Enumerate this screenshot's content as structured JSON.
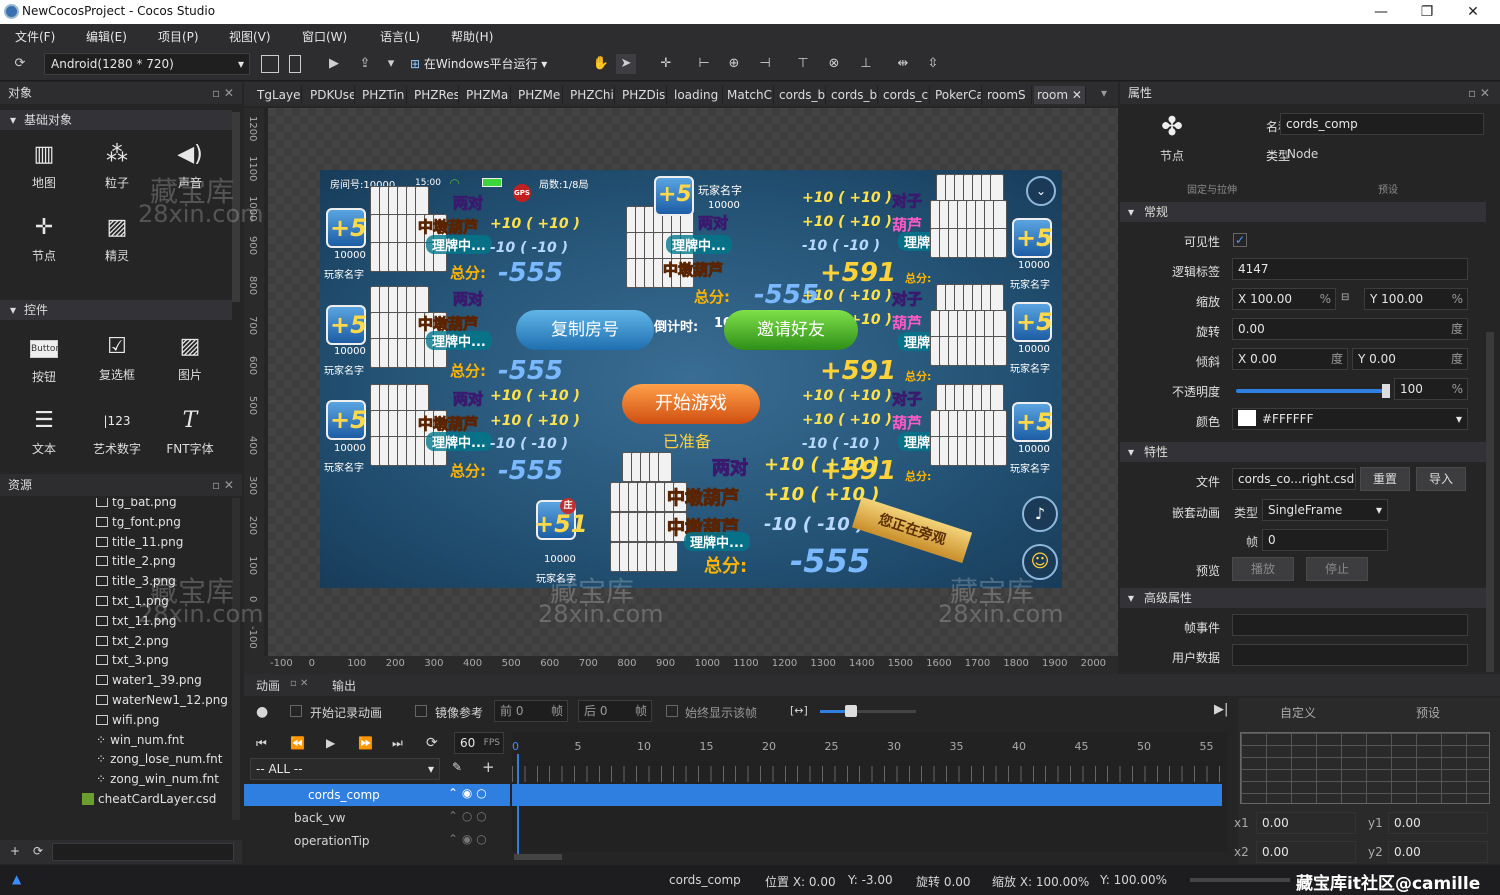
{
  "window": {
    "title": "NewCocosProject - Cocos Studio",
    "minimize": "—",
    "restore": "❐",
    "close": "✕"
  },
  "menu": [
    "文件(F)",
    "编辑(E)",
    "项目(P)",
    "视图(V)",
    "窗口(W)",
    "语言(L)",
    "帮助(H)"
  ],
  "toolbar": {
    "resolution": "Android(1280 * 720)",
    "run_label": "在Windows平台运行"
  },
  "objects_panel": {
    "title": "对象",
    "basic_section": "基础对象",
    "basic_items": [
      "地图",
      "粒子",
      "声音",
      "节点",
      "精灵"
    ],
    "controls_section": "控件",
    "control_items": [
      "按钮",
      "复选框",
      "图片",
      "文本",
      "艺术数字",
      "FNT字体"
    ]
  },
  "resources_panel": {
    "title": "资源",
    "files": [
      "tg_bat.png",
      "tg_font.png",
      "title_11.png",
      "title_2.png",
      "title_3.png",
      "txt_1.png",
      "txt_11.png",
      "txt_2.png",
      "txt_3.png",
      "water1_39.png",
      "waterNew1_12.png",
      "wifi.png",
      "win_num.fnt",
      "zong_lose_num.fnt",
      "zong_win_num.fnt",
      "cheatCardLayer.csd"
    ]
  },
  "tabs": [
    "TgLayer",
    "PDKUse",
    "PHZTin",
    "PHZRes",
    "PHZMa",
    "PHZMe",
    "PHZChi",
    "PHZDis",
    "loading",
    "MatchC",
    "cords_b",
    "cords_b",
    "cords_c",
    "PokerCa",
    "roomS",
    "room"
  ],
  "ruler_x": [
    "-100",
    "0",
    "100",
    "200",
    "300",
    "400",
    "500",
    "600",
    "700",
    "800",
    "900",
    "1000",
    "1100",
    "1200",
    "1300",
    "1400",
    "1500",
    "1600",
    "1700",
    "1800",
    "1900",
    "2000"
  ],
  "ruler_y": [
    "1200",
    "1100",
    "1000",
    "900",
    "800",
    "700",
    "600",
    "500",
    "400",
    "300",
    "200",
    "100",
    "0",
    "-100"
  ],
  "game": {
    "room": "房间号:10000",
    "time": "15:00",
    "rounds": "局数:1/8局",
    "player_name": "玩家名字",
    "score": "10000",
    "pair": "两对",
    "gourd": "中墩葫芦",
    "gourd2": "葫芦",
    "pair2": "对子",
    "plus": "+10 ( +10 )",
    "minus": "-10 ( -10 )",
    "arranging": "理牌中...",
    "total": "总分:",
    "total_neg": "-555",
    "total_pos": "+591",
    "copy_room": "复制房号",
    "countdown": "倒计时:",
    "countdown_val": "10",
    "invite": "邀请好友",
    "start": "开始游戏",
    "ready": "已准备",
    "watching": "您正在旁观",
    "zhuang": "庄",
    "gps": "GPS",
    "plus5": "+5",
    "plus51": "+51"
  },
  "properties": {
    "title": "属性",
    "node_label": "节点",
    "name_label": "名称",
    "name_value": "cords_comp",
    "type_label": "类型",
    "type_value": "Node",
    "fixed_stretch": "固定与拉伸",
    "preset": "预设",
    "general": "常规",
    "visible_label": "可见性",
    "tag_label": "逻辑标签",
    "tag_value": "4147",
    "scale_label": "缩放",
    "scale_x": "100.00",
    "scale_y": "100.00",
    "rotation_label": "旋转",
    "rotation_value": "0.00",
    "skew_label": "倾斜",
    "skew_x": "0.00",
    "skew_y": "0.00",
    "opacity_label": "不透明度",
    "opacity_value": "100",
    "color_label": "颜色",
    "color_value": "#FFFFFF",
    "feature": "特性",
    "file_label": "文件",
    "file_value": "cords_co...right.csd",
    "reset": "重置",
    "import": "导入",
    "anim_label": "嵌套动画",
    "anim_type_label": "类型",
    "anim_type": "SingleFrame",
    "frame_label": "帧",
    "frame_value": "0",
    "preview_label": "预览",
    "play": "播放",
    "stop": "停止",
    "advanced": "高级属性",
    "frame_event": "帧事件",
    "user_data": "用户数据",
    "x": "X",
    "y": "Y",
    "percent": "%",
    "degree": "度"
  },
  "animation": {
    "tab_anim": "动画",
    "tab_output": "输出",
    "record": "开始记录动画",
    "mirror": "镜像参考",
    "before": "前",
    "before_val": "0",
    "frame": "帧",
    "after": "后",
    "after_val": "0",
    "always_show": "始终显示该帧",
    "fps_value": "60",
    "fps": "FPS",
    "filter": "-- ALL --",
    "nodes": [
      "cords_comp",
      "back_vw",
      "operationTip"
    ],
    "frames": [
      "0",
      "5",
      "10",
      "15",
      "20",
      "25",
      "30",
      "35",
      "40",
      "45",
      "50",
      "55"
    ],
    "custom": "自定义",
    "preset": "预设",
    "x1": "x1",
    "x1v": "0.00",
    "y1": "y1",
    "y1v": "0.00",
    "x2": "x2",
    "x2v": "0.00",
    "y2": "y2",
    "y2v": "0.00"
  },
  "statusbar": {
    "node": "cords_comp",
    "pos": "位置 X: 0.00",
    "pos_y": "Y: -3.00",
    "rot": "旋转 0.00",
    "scale": "缩放 X: 100.00%",
    "scale_y": "Y: 100.00%",
    "brand": "藏宝库it社区@camille"
  },
  "watermark": {
    "cn": "藏宝库",
    "en": "28xin.com"
  },
  "colors": {
    "accent": "#1e74d6",
    "selection": "#2f7fe0",
    "panel": "#2d2d30",
    "orange_button": "#e8701e",
    "green_button": "#4aa822"
  }
}
